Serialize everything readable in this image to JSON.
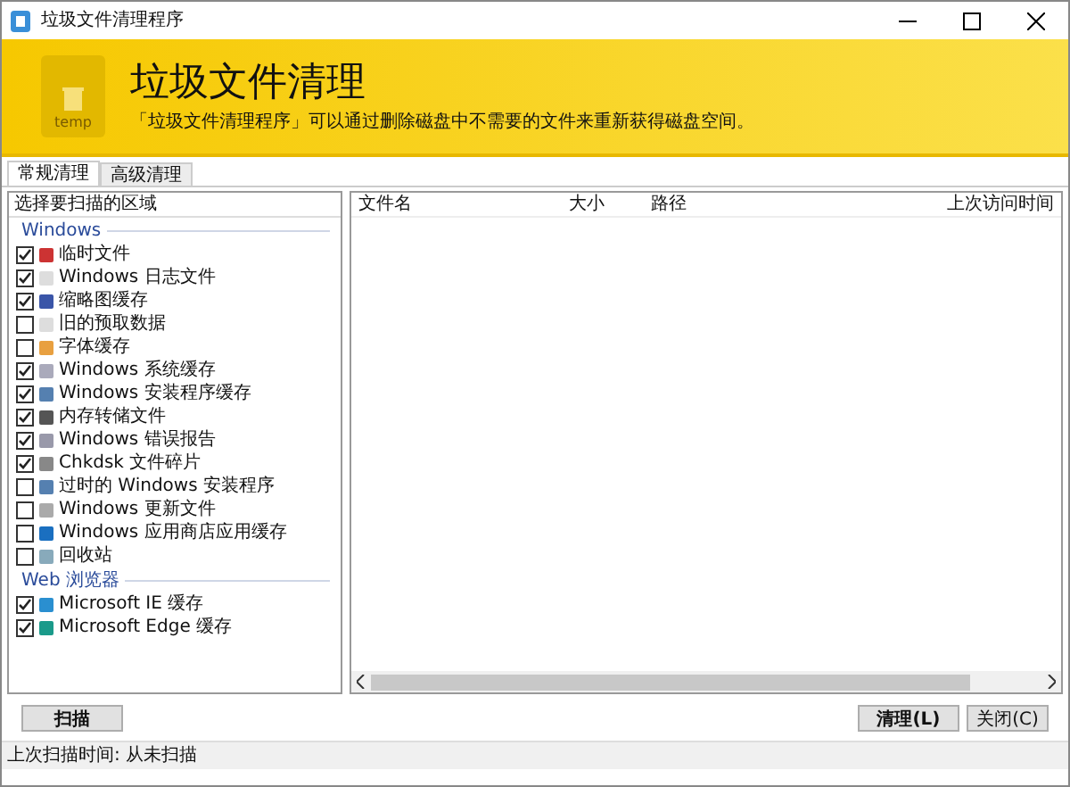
{
  "window": {
    "title": "垃圾文件清理程序"
  },
  "header": {
    "title": "垃圾文件清理",
    "subtitle": "「垃圾文件清理程序」可以通过删除磁盘中不需要的文件来重新获得磁盘空间。",
    "logo_text": "temp"
  },
  "tabs": [
    {
      "label": "常规清理",
      "selected": true
    },
    {
      "label": "高级清理",
      "selected": false
    }
  ],
  "areas": {
    "heading": "选择要扫描的区域",
    "groups": [
      {
        "name": "Windows",
        "items": [
          {
            "label": "临时文件",
            "checked": true
          },
          {
            "label": "Windows 日志文件",
            "checked": true
          },
          {
            "label": "缩略图缓存",
            "checked": true
          },
          {
            "label": "旧的预取数据",
            "checked": false
          },
          {
            "label": "字体缓存",
            "checked": false
          },
          {
            "label": "Windows 系统缓存",
            "checked": true
          },
          {
            "label": "Windows 安装程序缓存",
            "checked": true
          },
          {
            "label": "内存转储文件",
            "checked": true
          },
          {
            "label": "Windows 错误报告",
            "checked": true
          },
          {
            "label": "Chkdsk 文件碎片",
            "checked": true
          },
          {
            "label": "过时的 Windows 安装程序",
            "checked": false
          },
          {
            "label": "Windows 更新文件",
            "checked": false
          },
          {
            "label": "Windows 应用商店应用缓存",
            "checked": false
          },
          {
            "label": "回收站",
            "checked": false
          }
        ]
      },
      {
        "name": "Web 浏览器",
        "items": [
          {
            "label": "Microsoft IE 缓存",
            "checked": true
          },
          {
            "label": "Microsoft Edge 缓存",
            "checked": true
          }
        ]
      }
    ]
  },
  "table": {
    "columns": [
      "文件名",
      "大小",
      "路径",
      "上次访问时间"
    ]
  },
  "buttons": {
    "scan": "扫描",
    "clean": "清理(L)",
    "close": "关闭(C)"
  },
  "status_bar": "上次扫描时间: 从未扫描"
}
